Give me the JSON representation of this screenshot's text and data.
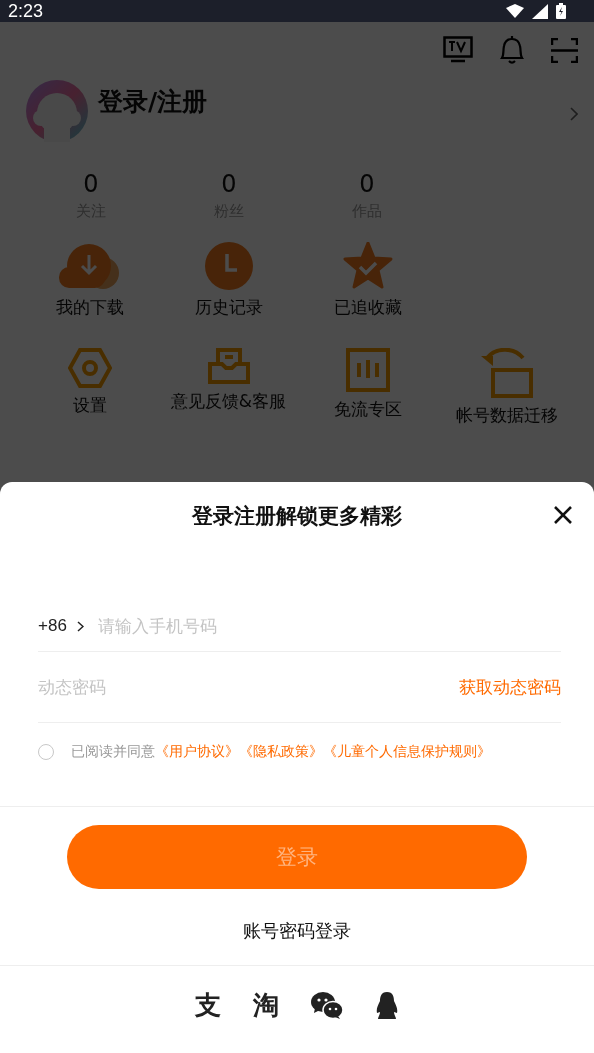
{
  "status_bar": {
    "time": "2:23"
  },
  "profile": {
    "title": "登录/注册"
  },
  "stats": [
    {
      "value": "0",
      "label": "关注"
    },
    {
      "value": "0",
      "label": "粉丝"
    },
    {
      "value": "0",
      "label": "作品"
    }
  ],
  "shortcuts": [
    {
      "kind": "download",
      "label": "我的下载"
    },
    {
      "kind": "history",
      "label": "历史记录"
    },
    {
      "kind": "favorite",
      "label": "已追收藏"
    }
  ],
  "tools": [
    {
      "kind": "settings",
      "label": "设置"
    },
    {
      "kind": "feedback",
      "label": "意见反馈&客服"
    },
    {
      "kind": "freeflow",
      "label": "免流专区"
    },
    {
      "kind": "migrate",
      "label": "帐号数据迁移"
    }
  ],
  "login_sheet": {
    "title": "登录注册解锁更多精彩",
    "country_code": "+86",
    "phone_placeholder": "请输入手机号码",
    "code_placeholder": "动态密码",
    "get_code": "获取动态密码",
    "agreement": {
      "checked": false,
      "text": "已阅读并同意",
      "links": [
        "《用户协议》",
        "《隐私政策》",
        "《儿童个人信息保护规则》"
      ]
    },
    "login_button": {
      "label": "登录",
      "disabled": true
    },
    "password_login": "账号密码登录",
    "third_party": [
      {
        "kind": "glyph",
        "label": "支"
      },
      {
        "kind": "glyph",
        "label": "淘"
      },
      {
        "kind": "wechat"
      },
      {
        "kind": "qq"
      }
    ]
  }
}
